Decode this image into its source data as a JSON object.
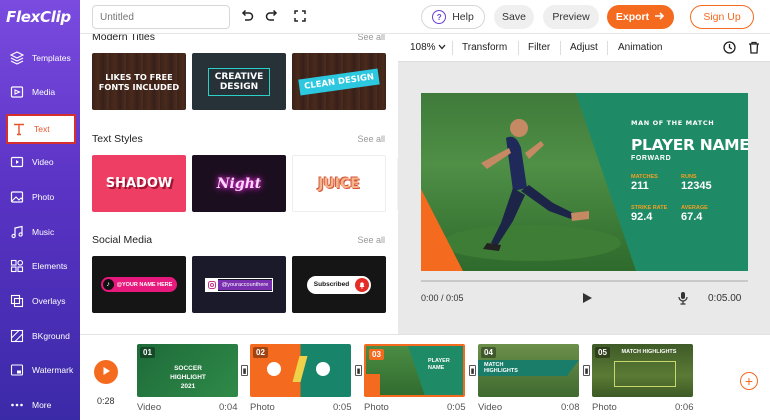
{
  "app": {
    "logo": "FlexClip"
  },
  "sidebar": {
    "items": [
      {
        "label": "Templates",
        "icon": "layers-icon"
      },
      {
        "label": "Media",
        "icon": "media-icon"
      },
      {
        "label": "Text",
        "icon": "text-icon",
        "active": true
      },
      {
        "label": "Video",
        "icon": "video-icon"
      },
      {
        "label": "Photo",
        "icon": "photo-icon"
      },
      {
        "label": "Music",
        "icon": "music-icon"
      },
      {
        "label": "Elements",
        "icon": "elements-icon"
      },
      {
        "label": "Overlays",
        "icon": "overlays-icon"
      },
      {
        "label": "BKground",
        "icon": "background-icon"
      },
      {
        "label": "Watermark",
        "icon": "watermark-icon"
      },
      {
        "label": "More",
        "icon": "more-icon"
      }
    ]
  },
  "topbar": {
    "title_placeholder": "Untitled",
    "help": "Help",
    "save": "Save",
    "preview": "Preview",
    "export": "Export",
    "signup": "Sign Up"
  },
  "panel": {
    "see_all": "See all",
    "sections": [
      {
        "title": "Modern Titles",
        "items": [
          {
            "line1": "LIKES TO FREE",
            "line2": "FONTS INCLUDED"
          },
          {
            "line1": "CREATIVE",
            "line2": "DESIGN"
          },
          {
            "line1": "CLEAN DESIGN",
            "line2": ""
          }
        ]
      },
      {
        "title": "Text Styles",
        "items": [
          {
            "text": "SHADOW"
          },
          {
            "text": "Night"
          },
          {
            "text": "JUICE"
          }
        ]
      },
      {
        "title": "Social Media",
        "items": [
          {
            "text": "@YOUR NAME HERE"
          },
          {
            "text": "@yourаccounthere"
          },
          {
            "text": "Subscribed"
          }
        ]
      }
    ]
  },
  "editor": {
    "toolbar": {
      "zoom": "108%",
      "transform": "Transform",
      "filter": "Filter",
      "adjust": "Adjust",
      "animation": "Animation"
    },
    "scene": {
      "kicker": "MAN OF THE MATCH",
      "name": "PLAYER NAME",
      "position": "FORWARD",
      "stats": [
        {
          "label": "MATCHES",
          "value": "211"
        },
        {
          "label": "RUNS",
          "value": "12345"
        },
        {
          "label": "STRIKE RATE",
          "value": "92.4"
        },
        {
          "label": "AVERAGE",
          "value": "67.4"
        }
      ]
    },
    "player": {
      "current_time": "0:00 / 0:05",
      "total_time": "0:05.00"
    }
  },
  "timeline": {
    "total": "0:28",
    "clips": [
      {
        "num": "01",
        "type": "Video",
        "duration": "0:04",
        "caption": "SOCCER HIGHLIGHT 2021"
      },
      {
        "num": "02",
        "type": "Photo",
        "duration": "0:05",
        "caption": ""
      },
      {
        "num": "03",
        "type": "Photo",
        "duration": "0:05",
        "caption": "PLAYER NAME",
        "selected": true
      },
      {
        "num": "04",
        "type": "Video",
        "duration": "0:08",
        "caption": "MATCH HIGHLIGHTS"
      },
      {
        "num": "05",
        "type": "Photo",
        "duration": "0:06",
        "caption": "MATCH HIGHLIGHTS"
      }
    ]
  },
  "colors": {
    "brand": "#6a3fd1",
    "accent": "#f46a1f",
    "scene_green": "#1f8a66"
  }
}
